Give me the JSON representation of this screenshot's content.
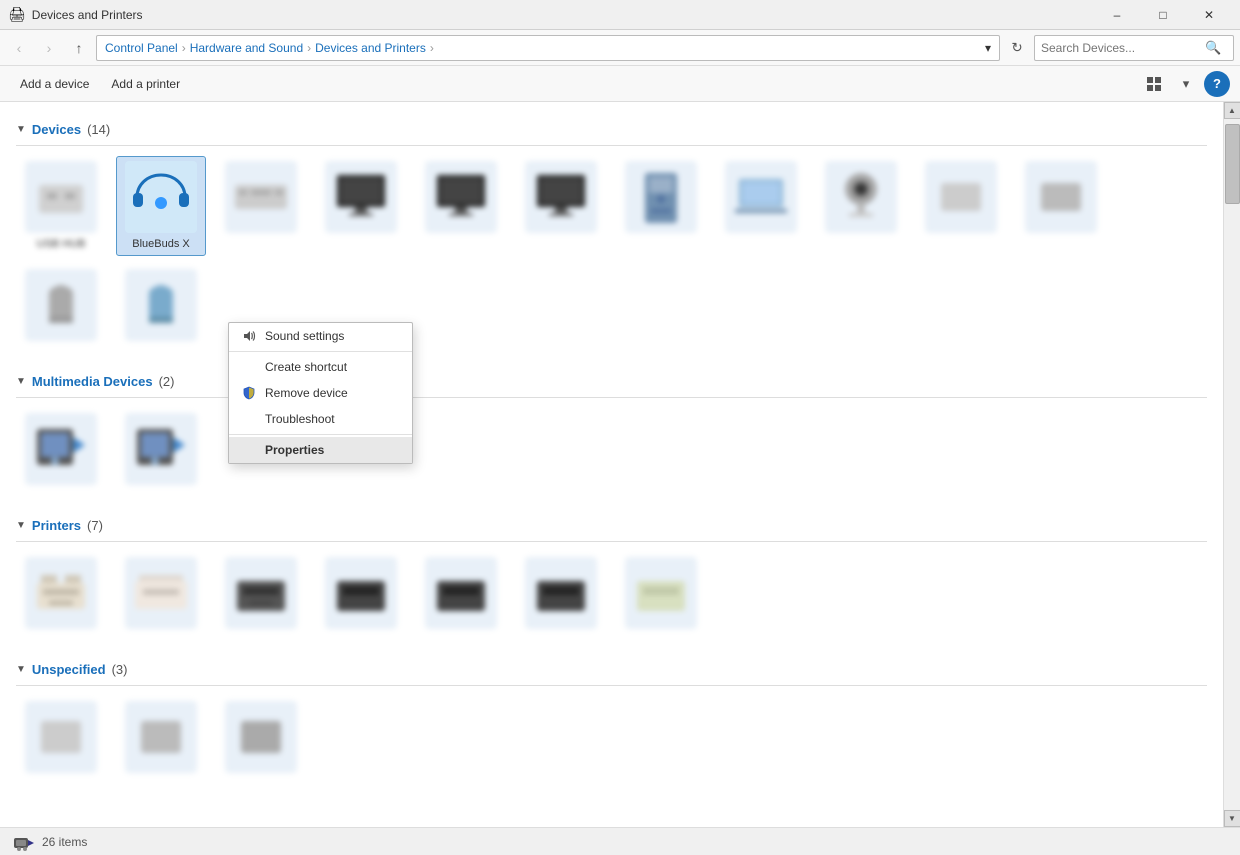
{
  "window": {
    "title": "Devices and Printers",
    "icon": "🖨"
  },
  "titlebar": {
    "minimize": "–",
    "maximize": "□",
    "close": "✕"
  },
  "addressbar": {
    "back": "‹",
    "forward": "›",
    "up": "↑",
    "breadcrumbs": [
      "Control Panel",
      "Hardware and Sound",
      "Devices and Printers"
    ],
    "search_placeholder": "Search Devices...",
    "refresh": "↻",
    "dropdown": "▾"
  },
  "toolbar": {
    "add_device": "Add a device",
    "add_printer": "Add a printer",
    "help": "?"
  },
  "sections": {
    "devices": {
      "label": "Devices",
      "count": "(14)"
    },
    "multimedia": {
      "label": "Multimedia Devices",
      "count": "(2)"
    },
    "printers": {
      "label": "Printers",
      "count": "(7)"
    },
    "unspecified": {
      "label": "Unspecified",
      "count": "(3)"
    }
  },
  "selected_device": {
    "name": "BlueBuds X"
  },
  "context_menu": {
    "items": [
      {
        "id": "sound-settings",
        "label": "Sound settings",
        "icon": "speaker",
        "bold": false
      },
      {
        "id": "create-shortcut",
        "label": "Create shortcut",
        "icon": "",
        "bold": false
      },
      {
        "id": "remove-device",
        "label": "Remove device",
        "icon": "shield",
        "bold": false
      },
      {
        "id": "troubleshoot",
        "label": "Troubleshoot",
        "icon": "",
        "bold": false
      },
      {
        "id": "properties",
        "label": "Properties",
        "icon": "",
        "bold": true
      }
    ]
  },
  "statusbar": {
    "count": "26 items"
  },
  "colors": {
    "accent": "#1a6fba",
    "selected_bg": "#cce0f5",
    "hover_bg": "#e8f0fe",
    "section_color": "#1a6fba"
  }
}
